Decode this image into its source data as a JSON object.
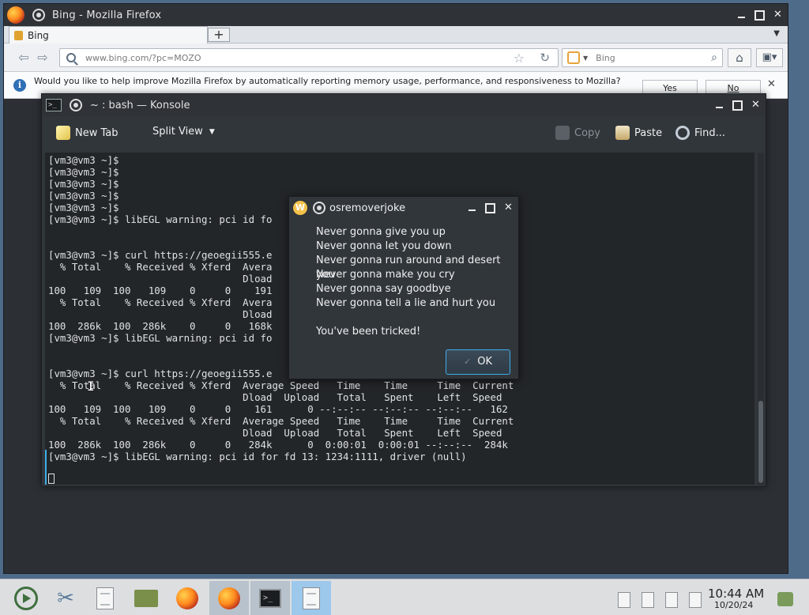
{
  "firefox": {
    "window_title": "Bing - Mozilla Firefox",
    "tab_title": "Bing",
    "new_tab_label": "+",
    "url": "www.bing.com/?pc=MOZO",
    "search_placeholder": "Bing",
    "notification": {
      "text": "Would you like to help improve Mozilla Firefox by automatically reporting memory usage, performance, and responsiveness to Mozilla?",
      "yes_label": "Yes",
      "no_label": "No"
    }
  },
  "konsole": {
    "window_title": "~ : bash — Konsole",
    "toolbar": {
      "new_tab": "New Tab",
      "split_view": "Split View",
      "copy": "Copy",
      "paste": "Paste",
      "find": "Find..."
    },
    "terminal_lines": [
      "[vm3@vm3 ~]$",
      "[vm3@vm3 ~]$",
      "[vm3@vm3 ~]$",
      "[vm3@vm3 ~]$",
      "[vm3@vm3 ~]$",
      "[vm3@vm3 ~]$ libEGL warning: pci id fo",
      "",
      "",
      "[vm3@vm3 ~]$ curl https://geoegii555.e",
      "  % Total    % Received % Xferd  Avera                                 rent",
      "                                 Dload                                 ed",
      "100   109  100   109    0     0    191                                191",
      "  % Total    % Received % Xferd  Avera                                 rent",
      "                                 Dload                                 ed",
      "100  286k  100  286k    0     0   168k                                68k",
      "[vm3@vm3 ~]$ libEGL warning: pci id fo",
      "",
      "",
      "[vm3@vm3 ~]$ curl https://geoegii555.e",
      "  % Total    % Received % Xferd  Average Speed   Time    Time     Time  Current",
      "                                 Dload  Upload   Total   Spent    Left  Speed",
      "100   109  100   109    0     0    161      0 --:--:-- --:--:-- --:--:--   162",
      "  % Total    % Received % Xferd  Average Speed   Time    Time     Time  Current",
      "                                 Dload  Upload   Total   Spent    Left  Speed",
      "100  286k  100  286k    0     0   284k      0  0:00:01  0:00:01 --:--:--  284k",
      "[vm3@vm3 ~]$ libEGL warning: pci id for fd 13: 1234:1111, driver (null)"
    ]
  },
  "dialog": {
    "title": "osremoverjoke",
    "logo_letter": "W",
    "lines": [
      "Never gonna give you up",
      "Never gonna let you down",
      "Never gonna run around and desert you",
      "Never gonna make you cry",
      "Never gonna say goodbye",
      "Never gonna tell a lie and hurt you",
      "",
      "You've been tricked!"
    ],
    "ok_label": "OK"
  },
  "taskbar": {
    "time": "10:44 AM",
    "date": "10/20/24"
  }
}
